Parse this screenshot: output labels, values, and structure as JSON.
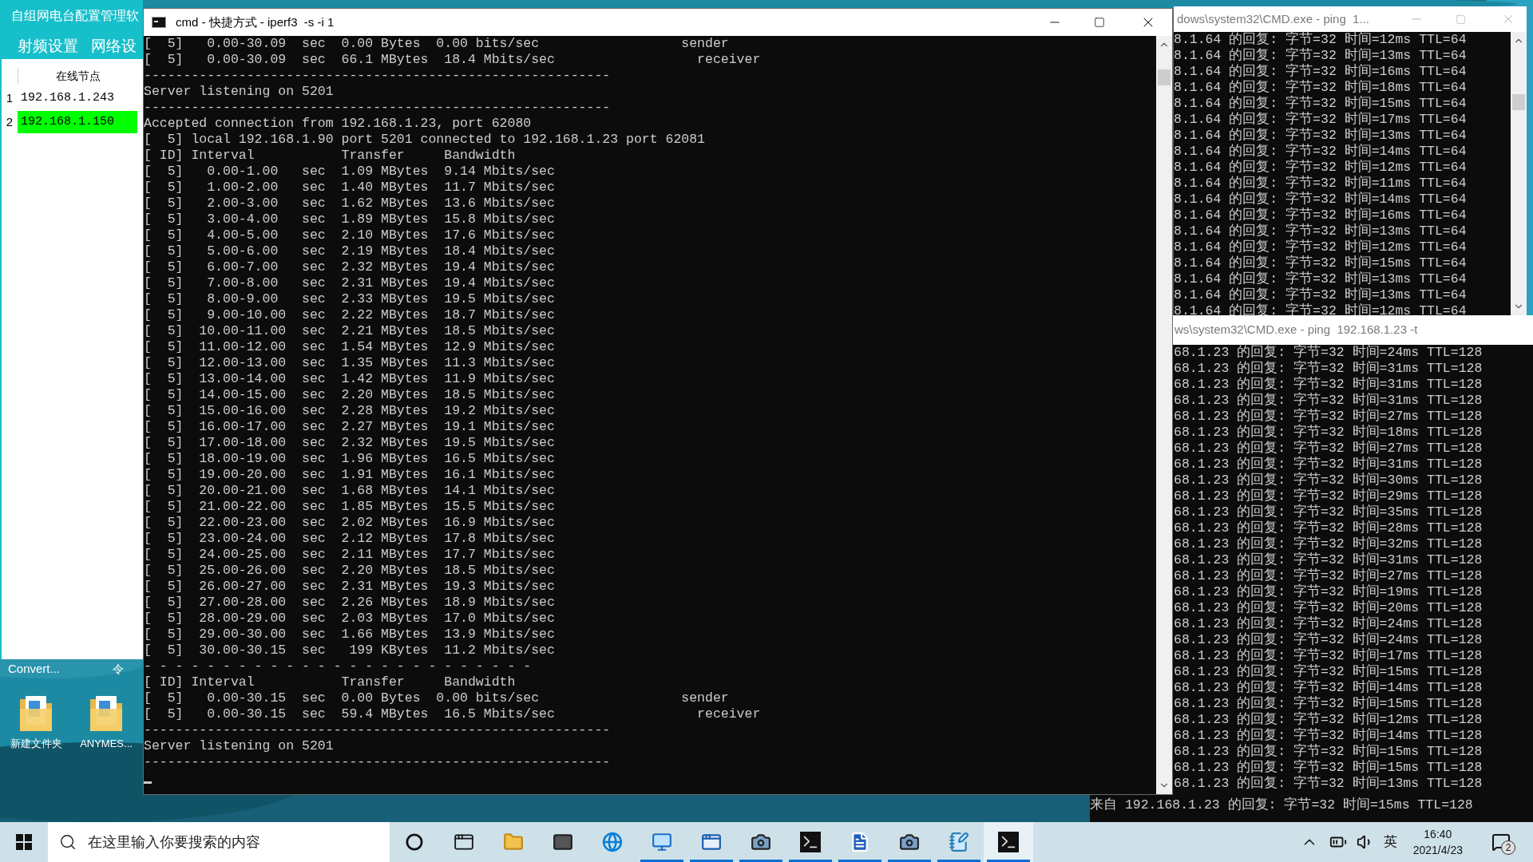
{
  "config_app": {
    "title": "自组网电台配置管理软",
    "menu": [
      {
        "label": "射频设置"
      },
      {
        "label": "网络设"
      }
    ],
    "table": {
      "header": "在线节点",
      "rows": [
        {
          "index": "1",
          "address": "192.168.1.243",
          "selected": false
        },
        {
          "index": "2",
          "address": "192.168.1.150",
          "selected": true
        }
      ]
    }
  },
  "partial_window": {
    "title": "Convert...",
    "symbol": "令"
  },
  "desktop_icons": [
    {
      "label": "新建文件夹"
    },
    {
      "label": "ANYMES..."
    }
  ],
  "iperf_window": {
    "title": "cmd - 快捷方式 - iperf3  -s -i 1",
    "active": true,
    "cursor": true,
    "lines": [
      "[  5]   0.00-30.09  sec  0.00 Bytes  0.00 bits/sec                  sender",
      "[  5]   0.00-30.09  sec  66.1 MBytes  18.4 Mbits/sec                  receiver",
      "-----------------------------------------------------------",
      "Server listening on 5201",
      "-----------------------------------------------------------",
      "Accepted connection from 192.168.1.23, port 62080",
      "[  5] local 192.168.1.90 port 5201 connected to 192.168.1.23 port 62081",
      "[ ID] Interval           Transfer     Bandwidth",
      "[  5]   0.00-1.00   sec  1.09 MBytes  9.14 Mbits/sec",
      "[  5]   1.00-2.00   sec  1.40 MBytes  11.7 Mbits/sec",
      "[  5]   2.00-3.00   sec  1.62 MBytes  13.6 Mbits/sec",
      "[  5]   3.00-4.00   sec  1.89 MBytes  15.8 Mbits/sec",
      "[  5]   4.00-5.00   sec  2.10 MBytes  17.6 Mbits/sec",
      "[  5]   5.00-6.00   sec  2.19 MBytes  18.4 Mbits/sec",
      "[  5]   6.00-7.00   sec  2.32 MBytes  19.4 Mbits/sec",
      "[  5]   7.00-8.00   sec  2.31 MBytes  19.4 Mbits/sec",
      "[  5]   8.00-9.00   sec  2.33 MBytes  19.5 Mbits/sec",
      "[  5]   9.00-10.00  sec  2.22 MBytes  18.7 Mbits/sec",
      "[  5]  10.00-11.00  sec  2.21 MBytes  18.5 Mbits/sec",
      "[  5]  11.00-12.00  sec  1.54 MBytes  12.9 Mbits/sec",
      "[  5]  12.00-13.00  sec  1.35 MBytes  11.3 Mbits/sec",
      "[  5]  13.00-14.00  sec  1.42 MBytes  11.9 Mbits/sec",
      "[  5]  14.00-15.00  sec  2.20 MBytes  18.5 Mbits/sec",
      "[  5]  15.00-16.00  sec  2.28 MBytes  19.2 Mbits/sec",
      "[  5]  16.00-17.00  sec  2.27 MBytes  19.1 Mbits/sec",
      "[  5]  17.00-18.00  sec  2.32 MBytes  19.5 Mbits/sec",
      "[  5]  18.00-19.00  sec  1.96 MBytes  16.5 Mbits/sec",
      "[  5]  19.00-20.00  sec  1.91 MBytes  16.1 Mbits/sec",
      "[  5]  20.00-21.00  sec  1.68 MBytes  14.1 Mbits/sec",
      "[  5]  21.00-22.00  sec  1.85 MBytes  15.5 Mbits/sec",
      "[  5]  22.00-23.00  sec  2.02 MBytes  16.9 Mbits/sec",
      "[  5]  23.00-24.00  sec  2.12 MBytes  17.8 Mbits/sec",
      "[  5]  24.00-25.00  sec  2.11 MBytes  17.7 Mbits/sec",
      "[  5]  25.00-26.00  sec  2.20 MBytes  18.5 Mbits/sec",
      "[  5]  26.00-27.00  sec  2.31 MBytes  19.3 Mbits/sec",
      "[  5]  27.00-28.00  sec  2.26 MBytes  18.9 Mbits/sec",
      "[  5]  28.00-29.00  sec  2.03 MBytes  17.0 Mbits/sec",
      "[  5]  29.00-30.00  sec  1.66 MBytes  13.9 Mbits/sec",
      "[  5]  30.00-30.15  sec   199 KBytes  11.2 Mbits/sec",
      "- - - - - - - - - - - - - - - - - - - - - - - - -",
      "[ ID] Interval           Transfer     Bandwidth",
      "[  5]   0.00-30.15  sec  0.00 Bytes  0.00 bits/sec                  sender",
      "[  5]   0.00-30.15  sec  59.4 MBytes  16.5 Mbits/sec                  receiver",
      "-----------------------------------------------------------",
      "Server listening on 5201",
      "-----------------------------------------------------------"
    ]
  },
  "ping_windows": [
    {
      "title": "dows\\system32\\CMD.exe - ping  1...",
      "active": false,
      "controls": true,
      "lines": [
        "8.1.64 的回复: 字节=32 时间=12ms TTL=64",
        "8.1.64 的回复: 字节=32 时间=13ms TTL=64",
        "8.1.64 的回复: 字节=32 时间=16ms TTL=64",
        "8.1.64 的回复: 字节=32 时间=18ms TTL=64",
        "8.1.64 的回复: 字节=32 时间=15ms TTL=64",
        "8.1.64 的回复: 字节=32 时间=17ms TTL=64",
        "8.1.64 的回复: 字节=32 时间=13ms TTL=64",
        "8.1.64 的回复: 字节=32 时间=14ms TTL=64",
        "8.1.64 的回复: 字节=32 时间=12ms TTL=64",
        "8.1.64 的回复: 字节=32 时间=11ms TTL=64",
        "8.1.64 的回复: 字节=32 时间=14ms TTL=64",
        "8.1.64 的回复: 字节=32 时间=16ms TTL=64",
        "8.1.64 的回复: 字节=32 时间=13ms TTL=64",
        "8.1.64 的回复: 字节=32 时间=12ms TTL=64",
        "8.1.64 的回复: 字节=32 时间=15ms TTL=64",
        "8.1.64 的回复: 字节=32 时间=13ms TTL=64",
        "8.1.64 的回复: 字节=32 时间=13ms TTL=64",
        "8.1.64 的回复: 字节=32 时间=12ms TTL=64"
      ]
    },
    {
      "title": "ws\\system32\\CMD.exe - ping  192.168.1.23 -t",
      "active": false,
      "controls": false,
      "lines": [
        "68.1.23 的回复: 字节=32 时间=24ms TTL=128",
        "68.1.23 的回复: 字节=32 时间=31ms TTL=128",
        "68.1.23 的回复: 字节=32 时间=31ms TTL=128",
        "68.1.23 的回复: 字节=32 时间=31ms TTL=128",
        "68.1.23 的回复: 字节=32 时间=27ms TTL=128",
        "68.1.23 的回复: 字节=32 时间=18ms TTL=128",
        "68.1.23 的回复: 字节=32 时间=27ms TTL=128",
        "68.1.23 的回复: 字节=32 时间=31ms TTL=128",
        "68.1.23 的回复: 字节=32 时间=30ms TTL=128",
        "68.1.23 的回复: 字节=32 时间=29ms TTL=128",
        "68.1.23 的回复: 字节=32 时间=35ms TTL=128",
        "68.1.23 的回复: 字节=32 时间=28ms TTL=128",
        "68.1.23 的回复: 字节=32 时间=32ms TTL=128",
        "68.1.23 的回复: 字节=32 时间=31ms TTL=128",
        "68.1.23 的回复: 字节=32 时间=27ms TTL=128",
        "68.1.23 的回复: 字节=32 时间=19ms TTL=128",
        "68.1.23 的回复: 字节=32 时间=20ms TTL=128",
        "68.1.23 的回复: 字节=32 时间=24ms TTL=128",
        "68.1.23 的回复: 字节=32 时间=24ms TTL=128",
        "68.1.23 的回复: 字节=32 时间=17ms TTL=128",
        "68.1.23 的回复: 字节=32 时间=15ms TTL=128",
        "68.1.23 的回复: 字节=32 时间=14ms TTL=128",
        "68.1.23 的回复: 字节=32 时间=15ms TTL=128",
        "68.1.23 的回复: 字节=32 时间=12ms TTL=128",
        "68.1.23 的回复: 字节=32 时间=14ms TTL=128",
        "68.1.23 的回复: 字节=32 时间=15ms TTL=128",
        "68.1.23 的回复: 字节=32 时间=15ms TTL=128",
        "68.1.23 的回复: 字节=32 时间=13ms TTL=128"
      ],
      "footer_line": "来自 192.168.1.23 的回复: 字节=32 时间=15ms TTL=128"
    }
  ],
  "taskbar": {
    "search": {
      "placeholder": "在这里输入你要搜索的内容"
    },
    "apps": [
      {
        "kind": "cortana",
        "running": false,
        "selected": false
      },
      {
        "kind": "task-view",
        "running": false,
        "selected": false
      },
      {
        "kind": "folder",
        "running": false,
        "selected": false
      },
      {
        "kind": "mail",
        "running": false,
        "selected": false
      },
      {
        "kind": "browser",
        "running": false,
        "selected": false
      },
      {
        "kind": "dashboard",
        "running": true,
        "selected": false
      },
      {
        "kind": "window",
        "running": true,
        "selected": false
      },
      {
        "kind": "camera",
        "running": true,
        "selected": false
      },
      {
        "kind": "terminal",
        "running": true,
        "selected": false
      },
      {
        "kind": "document",
        "running": true,
        "selected": false
      },
      {
        "kind": "camera",
        "running": true,
        "selected": false
      },
      {
        "kind": "notepad",
        "running": true,
        "selected": false
      },
      {
        "kind": "terminal",
        "running": true,
        "selected": true
      }
    ],
    "ime": "英",
    "time": "16:40",
    "date": "2021/4/23",
    "notifications": "2"
  }
}
